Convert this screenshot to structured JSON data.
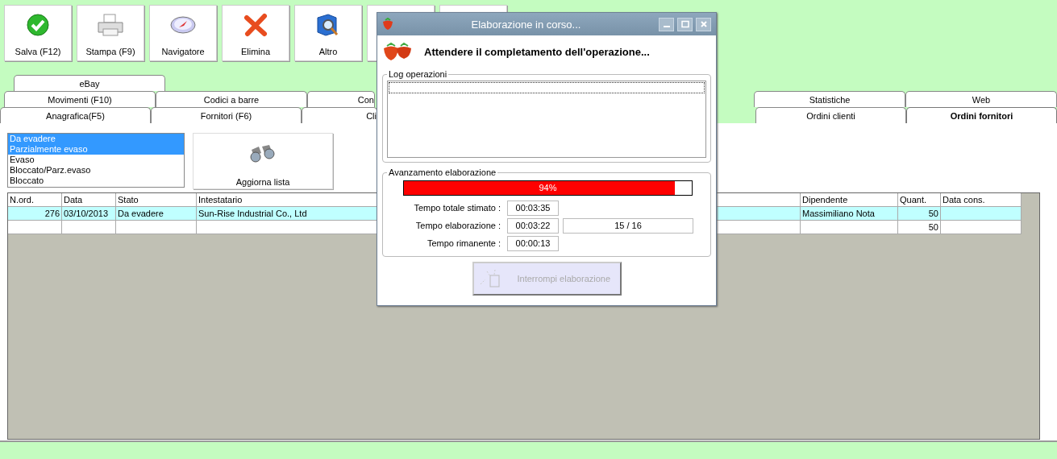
{
  "toolbar": [
    {
      "kind": "save",
      "label": "Salva (F12)"
    },
    {
      "kind": "print",
      "label": "Stampa (F9)"
    },
    {
      "kind": "compass",
      "label": "Navigatore"
    },
    {
      "kind": "delete",
      "label": "Elimina"
    },
    {
      "kind": "more",
      "label": "Altro"
    },
    {
      "kind": "covered"
    },
    {
      "kind": "covered"
    }
  ],
  "tab_rows": [
    [
      {
        "label": "eBay",
        "selected": false,
        "kind": "tab"
      }
    ],
    [
      {
        "label": "Movimenti (F10)",
        "selected": false,
        "kind": "tab"
      },
      {
        "label": "Codici a barre",
        "selected": false,
        "kind": "tab"
      },
      {
        "label": "Con",
        "selected": false,
        "kind": "covered"
      },
      {
        "label": "Statistiche",
        "selected": false,
        "kind": "tab"
      },
      {
        "label": "Web",
        "selected": false,
        "kind": "tab"
      }
    ],
    [
      {
        "label": "Anagrafica(F5)",
        "selected": false,
        "kind": "tab"
      },
      {
        "label": "Fornitori (F6)",
        "selected": false,
        "kind": "tab"
      },
      {
        "label": "Cli",
        "selected": false,
        "kind": "covered"
      },
      {
        "label": "Ordini clienti",
        "selected": false,
        "kind": "tab"
      },
      {
        "label": "Ordini fornitori",
        "selected": true,
        "kind": "tab"
      }
    ]
  ],
  "status_filter": [
    {
      "label": "Da evadere",
      "selected": true
    },
    {
      "label": "Parzialmente evaso",
      "selected": true
    },
    {
      "label": "Evaso",
      "selected": false
    },
    {
      "label": "Bloccato/Parz.evaso",
      "selected": false
    },
    {
      "label": "Bloccato",
      "selected": false
    }
  ],
  "refresh_button": {
    "label": "Aggiorna lista"
  },
  "table": {
    "columns": [
      "N.ord.",
      "Data",
      "Stato",
      "Intestatario",
      "Dipendente",
      "Quant.",
      "Data cons."
    ],
    "rows": [
      {
        "selected": true,
        "cells": [
          "276",
          "03/10/2013",
          "Da evadere",
          "Sun-Rise Industrial Co., Ltd",
          "Massimiliano Nota",
          "50",
          ""
        ]
      },
      {
        "selected": false,
        "cells": [
          "",
          "",
          "",
          "",
          "",
          "50",
          ""
        ]
      }
    ]
  },
  "dialog": {
    "title": "Elaborazione in corso...",
    "heading": "Attendere il completamento dell'operazione...",
    "log": {
      "title": "Log operazioni"
    },
    "progress": {
      "title": "Avanzamento elaborazione",
      "level": 0.94,
      "reading": "94%",
      "fields": [
        {
          "label": "Tempo totale stimato :",
          "value": "00:03:35"
        },
        {
          "label": "Tempo elaborazione :",
          "value": "00:03:22",
          "counter": "15 / 16"
        },
        {
          "label": "Tempo rimanente :",
          "value": "00:00:13"
        }
      ]
    },
    "stop_button": {
      "label": "Interrompi elaborazione",
      "disabled": true
    }
  }
}
